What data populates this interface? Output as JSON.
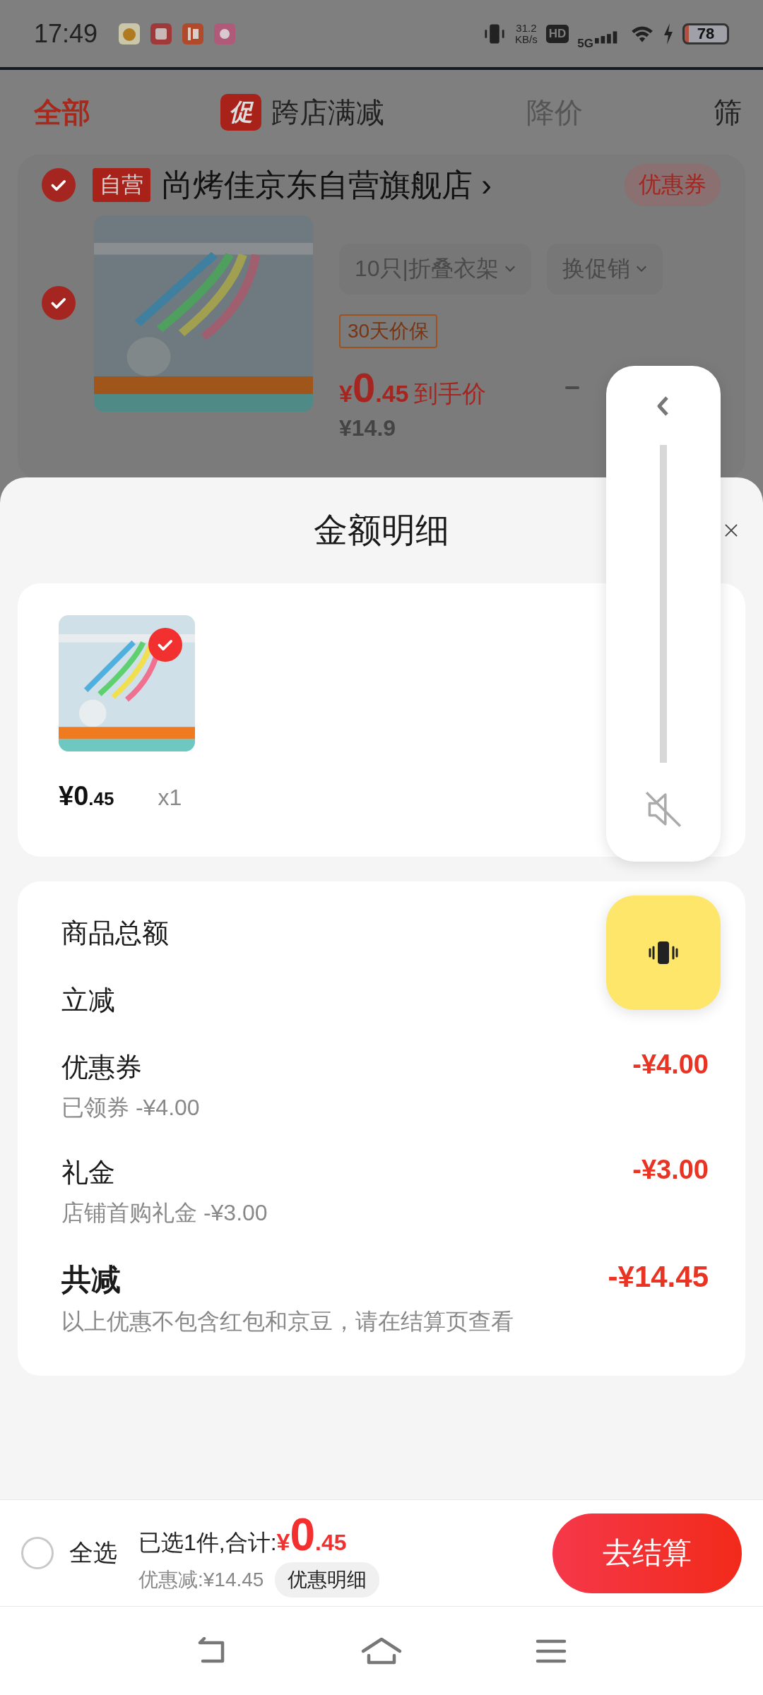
{
  "status_bar": {
    "time": "17:49",
    "net_speed": "31.2",
    "net_unit": "KB/s",
    "hd": "HD",
    "network": "5G",
    "battery": "78",
    "charging": true
  },
  "filter_tabs": [
    {
      "label": "全部",
      "selected": true
    },
    {
      "label": "跨店满减",
      "selected": false,
      "badge": "促"
    },
    {
      "label": "降价",
      "selected": false
    },
    {
      "label": "筛",
      "selected": false
    }
  ],
  "store": {
    "checked": true,
    "tag": "自营",
    "name": "尚烤佳京东自营旗舰店",
    "arrow": "›",
    "coupon": "优惠券"
  },
  "cart_item": {
    "checked": true,
    "spec": "10只|折叠衣架",
    "promo": "换促销",
    "guarantee": "30天价保",
    "price_symbol": "¥",
    "price_int": "0",
    "price_dec": ".45",
    "price_note": "到手价",
    "original_price": "¥14.9"
  },
  "sheet": {
    "title": "金额明细",
    "items": [
      {
        "checked": true,
        "price_symbol": "¥",
        "price_int": "0",
        "price_dec": ".45",
        "quantity": "x1"
      }
    ],
    "details": [
      {
        "kind": "line",
        "label": "商品总额"
      },
      {
        "kind": "line",
        "label": "立减"
      },
      {
        "kind": "line",
        "label": "优惠券",
        "value": "-¥4.00",
        "note": "已领券 -¥4.00"
      },
      {
        "kind": "line",
        "label": "礼金",
        "value": "-¥3.00",
        "note": "店铺首购礼金 -¥3.00"
      },
      {
        "kind": "total",
        "label": "共减",
        "value": "-¥14.45",
        "note": "以上优惠不包含红包和京豆，请在结算页查看"
      }
    ]
  },
  "checkout_bar": {
    "select_all_checked": false,
    "select_all_label": "全选",
    "summary": "已选1件,合计:",
    "total_symbol": "¥",
    "total_int": "0",
    "total_dec": ".45",
    "discount": "优惠减:¥14.45",
    "detail_button": "优惠明细",
    "checkout_button": "去结算"
  },
  "volume_panel": {
    "muted": true
  }
}
